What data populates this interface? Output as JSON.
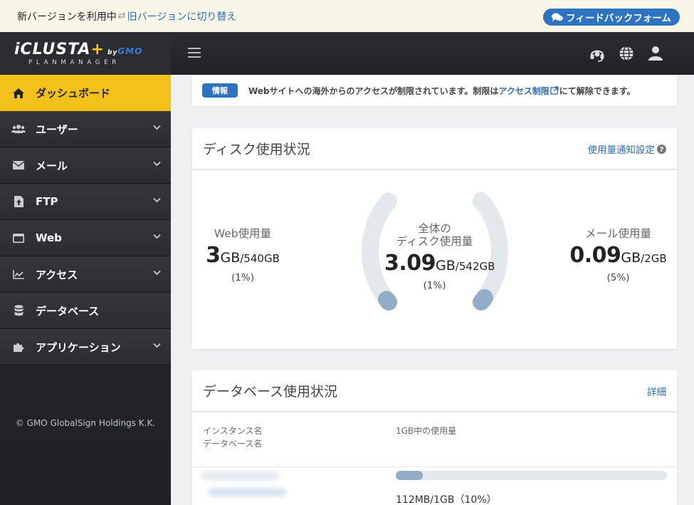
{
  "notice": {
    "text": "新バージョンを利用中",
    "swap_icon": "swap-icon",
    "link": "旧バージョンに切り替え",
    "feedback_label": "フィードバックフォーム"
  },
  "logo": {
    "brand": "iCLUSTA",
    "by": "by",
    "gmo": "GMO",
    "sub": "PLANMANAGER"
  },
  "sidebar": {
    "items": [
      {
        "label": "ダッシュボード",
        "icon": "home-icon",
        "active": true,
        "chevron": false
      },
      {
        "label": "ユーザー",
        "icon": "users-icon",
        "chevron": true
      },
      {
        "label": "メール",
        "icon": "envelope-icon",
        "chevron": true
      },
      {
        "label": "FTP",
        "icon": "file-upload-icon",
        "chevron": true
      },
      {
        "label": "Web",
        "icon": "browser-window-icon",
        "chevron": true
      },
      {
        "label": "アクセス",
        "icon": "line-chart-icon",
        "chevron": true
      },
      {
        "label": "データベース",
        "icon": "database-icon",
        "chevron": false
      },
      {
        "label": "アプリケーション",
        "icon": "puzzle-icon",
        "chevron": true
      }
    ],
    "copyright": "© GMO GlobalSign Holdings K.K."
  },
  "info": {
    "badge": "情報",
    "text_before": "Webサイトへの海外からのアクセスが制限されています。制限は",
    "link": "アクセス制限",
    "text_after": "にて解除できます。"
  },
  "disk": {
    "title": "ディスク使用状況",
    "settings_link": "使用量通知設定",
    "web": {
      "label": "Web使用量",
      "value": "3",
      "unit": "GB",
      "total": "/540GB",
      "percent": "(1%)",
      "fraction": 0.01
    },
    "total": {
      "label1": "全体の",
      "label2": "ディスク使用量",
      "value": "3.09",
      "unit": "GB",
      "total": "/542GB",
      "percent": "(1%)"
    },
    "mail": {
      "label": "メール使用量",
      "value": "0.09",
      "unit": "GB",
      "total": "/2GB",
      "percent": "(5%)",
      "fraction": 0.05
    }
  },
  "database": {
    "title": "データベース使用状況",
    "detail_link": "詳細",
    "col_instance": "インスタンス名",
    "col_dbname": "データベース名",
    "col_usage": "1GB中の使用量",
    "rows": [
      {
        "usage_text": "112MB/1GB（10%）",
        "fraction": 0.1
      }
    ]
  },
  "colors": {
    "accent": "#f2c21b",
    "link": "#2d6db5",
    "button": "#2e73c0",
    "gauge_fill": "#92aec7",
    "gauge_track": "#e3e8ec"
  }
}
